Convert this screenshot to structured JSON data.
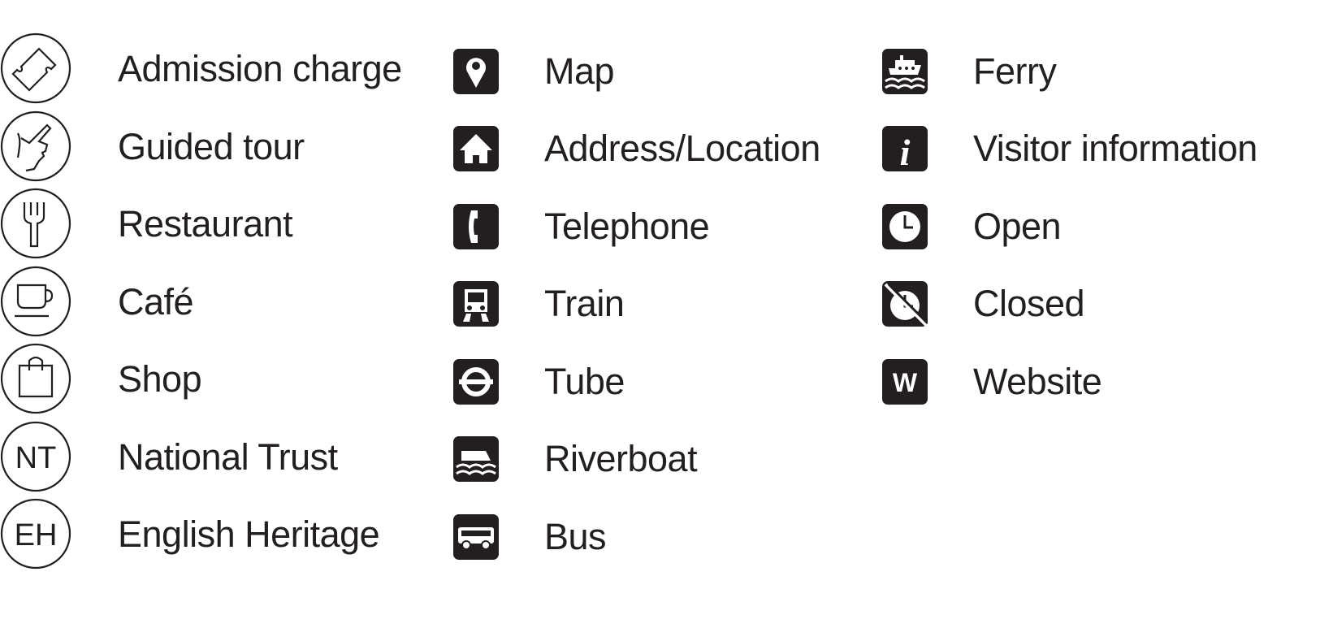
{
  "columns": [
    {
      "items": [
        {
          "icon": "admission-ticket-icon",
          "label": "Admission charge"
        },
        {
          "icon": "guided-tour-hand-icon",
          "label": "Guided tour"
        },
        {
          "icon": "restaurant-fork-icon",
          "label": "Restaurant"
        },
        {
          "icon": "cafe-cup-icon",
          "label": "Café"
        },
        {
          "icon": "shop-bag-icon",
          "label": "Shop"
        },
        {
          "icon": "national-trust-icon",
          "label": "National Trust",
          "icon_text": "NT"
        },
        {
          "icon": "english-heritage-icon",
          "label": "English Heritage",
          "icon_text": "EH"
        }
      ]
    },
    {
      "items": [
        {
          "icon": "map-pin-icon",
          "label": "Map"
        },
        {
          "icon": "house-icon",
          "label": "Address/Location"
        },
        {
          "icon": "telephone-icon",
          "label": "Telephone"
        },
        {
          "icon": "train-icon",
          "label": "Train"
        },
        {
          "icon": "tube-roundel-icon",
          "label": "Tube"
        },
        {
          "icon": "riverboat-icon",
          "label": "Riverboat"
        },
        {
          "icon": "bus-icon",
          "label": "Bus"
        }
      ]
    },
    {
      "items": [
        {
          "icon": "ferry-icon",
          "label": "Ferry"
        },
        {
          "icon": "info-icon",
          "label": "Visitor information",
          "icon_text": "i"
        },
        {
          "icon": "clock-icon",
          "label": "Open"
        },
        {
          "icon": "clock-crossed-icon",
          "label": "Closed"
        },
        {
          "icon": "website-icon",
          "label": "Website",
          "icon_text": "W"
        }
      ]
    }
  ],
  "colors": {
    "ink": "#231f20",
    "background": "#ffffff"
  }
}
